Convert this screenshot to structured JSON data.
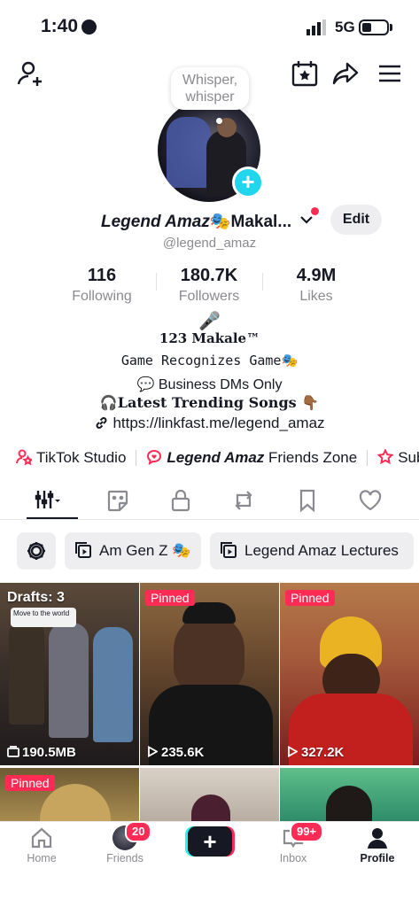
{
  "status_bar": {
    "time": "1:40",
    "network": "5G"
  },
  "profile": {
    "whisper": "Whisper, whisper",
    "display_name_prefix": "Legend Amaz",
    "display_name_suffix": "🎭Makal...",
    "username": "@legend_amaz",
    "edit_label": "Edit"
  },
  "stats": [
    {
      "value": "116",
      "label": "Following"
    },
    {
      "value": "180.7K",
      "label": "Followers"
    },
    {
      "value": "4.9M",
      "label": "Likes"
    }
  ],
  "bio": {
    "line1": "🎤",
    "line2": "123  Makale™",
    "line3": "Game Recognizes Game🎭",
    "line4": "💬  Business DMs Only",
    "line5": "🎧Latest Trending Songs 👇🏾",
    "link": "https://linkfast.me/legend_amaz"
  },
  "shortcuts": {
    "studio": "TikTok Studio",
    "friends_zone_name": "Legend Amaz",
    "friends_zone_rest": " Friends Zone",
    "third": "Sub"
  },
  "playlists": [
    "Am Gen Z 🎭",
    "Legend Amaz Lectures"
  ],
  "videos": [
    {
      "badge": "Drafts: 3",
      "caption": "Move to the world",
      "stat": "190.5MB",
      "pinned": false
    },
    {
      "badge": "Pinned",
      "stat": "235.6K",
      "pinned": true
    },
    {
      "badge": "Pinned",
      "stat": "327.2K",
      "pinned": true
    },
    {
      "badge": "Pinned",
      "stat": "",
      "pinned": true
    },
    {
      "badge": "",
      "stat": "",
      "pinned": false
    },
    {
      "badge": "",
      "stat": "",
      "pinned": false
    }
  ],
  "nav": {
    "home": "Home",
    "friends": "Friends",
    "friends_badge": "20",
    "inbox": "Inbox",
    "inbox_badge": "99+",
    "profile": "Profile"
  },
  "colors": {
    "accent": "#fe2c55",
    "cyan": "#20d5ec",
    "text": "#161823",
    "muted": "#8a8b91"
  }
}
